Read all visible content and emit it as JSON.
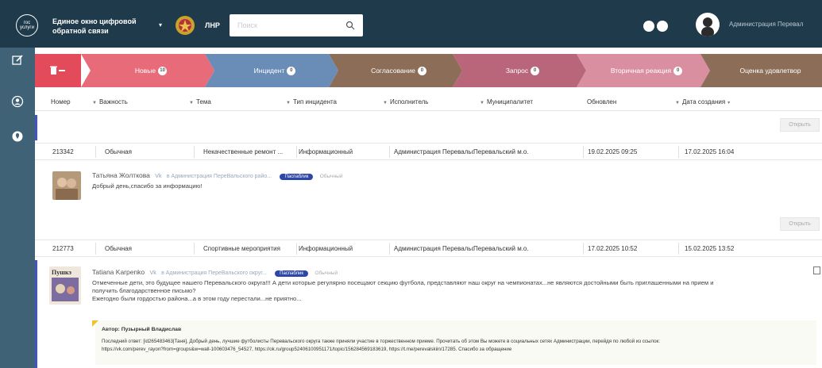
{
  "header": {
    "logo_text": "гос услуги",
    "app_title_line1": "Единое окно цифровой",
    "app_title_line2": "обратной связи",
    "region": "ЛНР",
    "search_placeholder": "Поиск",
    "user_name": "Администрация Перевал"
  },
  "pipeline": {
    "stages": [
      {
        "label": "Новые",
        "count": "10",
        "color": "#e86b7a"
      },
      {
        "label": "Инцидент",
        "count": "0",
        "color": "#6a8db8"
      },
      {
        "label": "Согласование",
        "count": "0",
        "color": "#8b6d58"
      },
      {
        "label": "Запрос",
        "count": "0",
        "color": "#b9667b"
      },
      {
        "label": "Вторичная реакция",
        "count": "0",
        "color": "#d98fa0"
      },
      {
        "label": "Оценка удовлетвор",
        "count": "",
        "color": "#8b6d58"
      }
    ]
  },
  "columns": [
    "Номер",
    "Важность",
    "Тема",
    "Тип инцидента",
    "Исполнитель",
    "Муниципалитет",
    "Обновлен",
    "Дата создания"
  ],
  "open_label": "Открыть",
  "rows": [
    {
      "number": "213342",
      "importance": "Обычная",
      "topic": "Некачественные ремонт ...",
      "type": "Информационный",
      "executor": "Администрация Перевальск",
      "municipality": "Перевальский м.о.",
      "updated": "19.02.2025 09:25",
      "created": "17.02.2025 16:04",
      "author": "Татьяна Жолткова",
      "vk": "Vk",
      "in_org": "в Администрация ПереВальского райо...",
      "pub": "Паспаблик",
      "kind": "Обычный",
      "text": "Добрый день,спасибо за информацию!"
    },
    {
      "number": "212773",
      "importance": "Обычная",
      "topic": "Спортивные мероприятия",
      "type": "Информационный",
      "executor": "Администрация Перевальск",
      "municipality": "Перевальский м.о.",
      "updated": "17.02.2025 10:52",
      "created": "15.02.2025 13:52",
      "author": "Tatiana Karpenko",
      "vk": "Vk",
      "in_org": "в Администрация ПереВальского округ...",
      "pub": "Паспаблик",
      "kind": "Обычный",
      "text_line1": "Отмеченные дети, это будущее нашего Перевальского округа!!! А дети которые регулярно посещают секцию футбола, представляют наш округ на чемпионатах...не являются достойными быть приглашенными на прием и",
      "text_line2": "получить благодарственное письмо?",
      "text_line3": "Ежегодно были гордостью района...а в этом году перестали...не приятно...",
      "reply_author": "Автор: Пузырный Владислав",
      "reply_text_line1": "Последний ответ: [id265483463|Таня], Добрый день, лучшие футболисты Перевальского округа также приняли участие в торжественном приеме. Прочитать об этом Вы можете в социальных сетях Администрации, перейдя по любой из ссылок:",
      "reply_text_line2": "https://vk.com/perev_rayon?from=groups&w=wall-100603476_54527, https://ok.ru/group52406100951171/topic/156284569183619, https://t.me/perevalskiin/17285. Спасибо за обращение",
      "photo_caption": "Пушкэ"
    }
  ]
}
